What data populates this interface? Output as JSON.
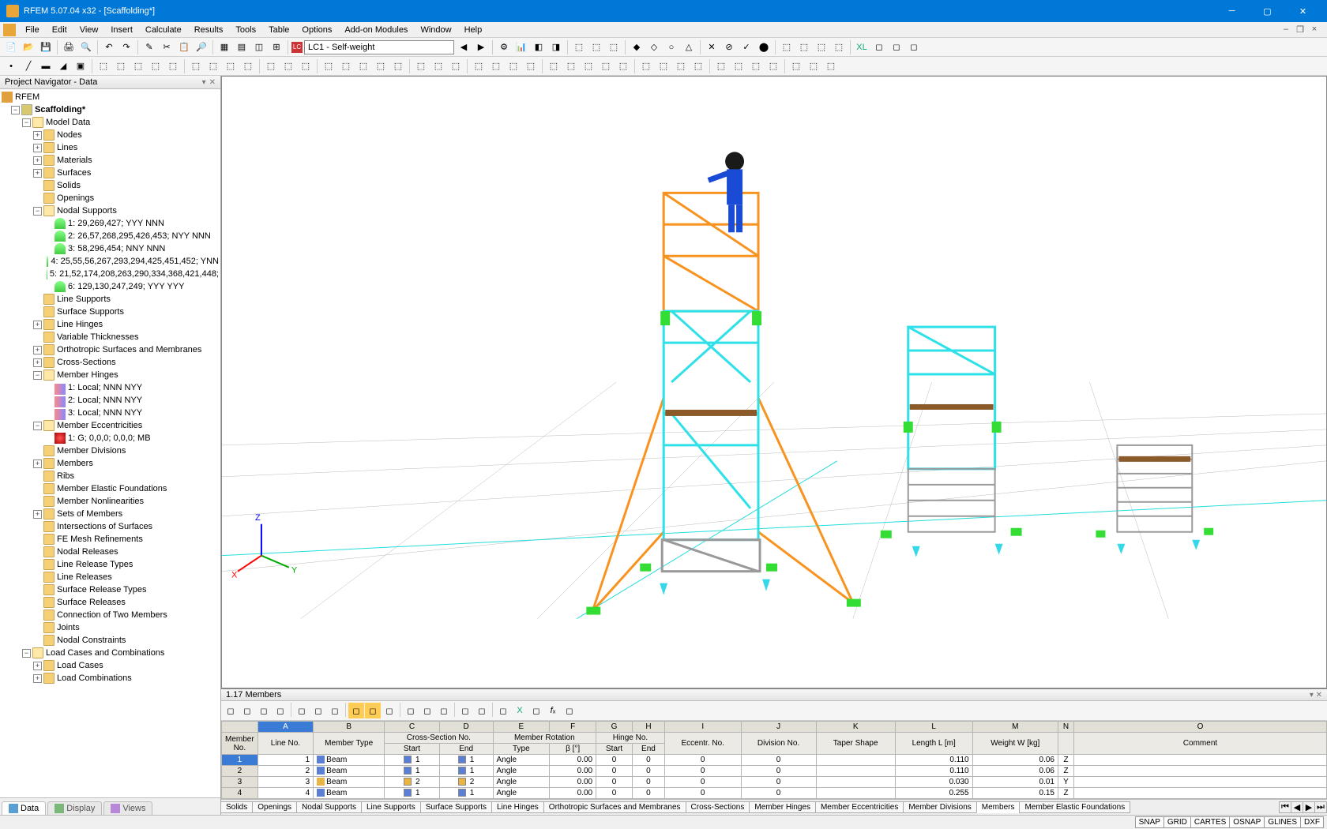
{
  "window": {
    "title": "RFEM 5.07.04 x32 - [Scaffolding*]"
  },
  "menu": [
    "File",
    "Edit",
    "View",
    "Insert",
    "Calculate",
    "Results",
    "Tools",
    "Table",
    "Options",
    "Add-on Modules",
    "Window",
    "Help"
  ],
  "loadcase": {
    "icon": "LC",
    "text": "LC1 - Self-weight"
  },
  "navigator": {
    "title": "Project Navigator - Data",
    "root": "RFEM",
    "project": "Scaffolding*",
    "model_data": "Model Data",
    "tree": [
      {
        "d": 3,
        "e": "+",
        "ic": "folder",
        "t": "Nodes"
      },
      {
        "d": 3,
        "e": "+",
        "ic": "folder",
        "t": "Lines"
      },
      {
        "d": 3,
        "e": "+",
        "ic": "folder",
        "t": "Materials"
      },
      {
        "d": 3,
        "e": "+",
        "ic": "folder",
        "t": "Surfaces"
      },
      {
        "d": 3,
        "e": "",
        "ic": "folder",
        "t": "Solids"
      },
      {
        "d": 3,
        "e": "",
        "ic": "folder",
        "t": "Openings"
      },
      {
        "d": 3,
        "e": "-",
        "ic": "folder-o",
        "t": "Nodal Supports"
      },
      {
        "d": 4,
        "e": "",
        "ic": "sup",
        "t": "1: 29,269,427; YYY NNN"
      },
      {
        "d": 4,
        "e": "",
        "ic": "sup",
        "t": "2: 26,57,268,295,426,453; NYY NNN"
      },
      {
        "d": 4,
        "e": "",
        "ic": "sup",
        "t": "3: 58,296,454; NNY NNN"
      },
      {
        "d": 4,
        "e": "",
        "ic": "sup",
        "t": "4: 25,55,56,267,293,294,425,451,452; YNN"
      },
      {
        "d": 4,
        "e": "",
        "ic": "sup",
        "t": "5: 21,52,174,208,263,290,334,368,421,448;"
      },
      {
        "d": 4,
        "e": "",
        "ic": "sup",
        "t": "6: 129,130,247,249; YYY YYY"
      },
      {
        "d": 3,
        "e": "",
        "ic": "folder",
        "t": "Line Supports"
      },
      {
        "d": 3,
        "e": "",
        "ic": "folder",
        "t": "Surface Supports"
      },
      {
        "d": 3,
        "e": "+",
        "ic": "folder",
        "t": "Line Hinges"
      },
      {
        "d": 3,
        "e": "",
        "ic": "folder",
        "t": "Variable Thicknesses"
      },
      {
        "d": 3,
        "e": "+",
        "ic": "folder",
        "t": "Orthotropic Surfaces and Membranes"
      },
      {
        "d": 3,
        "e": "+",
        "ic": "folder",
        "t": "Cross-Sections"
      },
      {
        "d": 3,
        "e": "-",
        "ic": "folder-o",
        "t": "Member Hinges"
      },
      {
        "d": 4,
        "e": "",
        "ic": "hinge",
        "t": "1: Local; NNN NYY"
      },
      {
        "d": 4,
        "e": "",
        "ic": "hinge",
        "t": "2: Local; NNN NYY"
      },
      {
        "d": 4,
        "e": "",
        "ic": "hinge",
        "t": "3: Local; NNN NYY"
      },
      {
        "d": 3,
        "e": "-",
        "ic": "folder-o",
        "t": "Member Eccentricities"
      },
      {
        "d": 4,
        "e": "",
        "ic": "ecc",
        "t": "1: G; 0,0,0; 0,0,0; MB"
      },
      {
        "d": 3,
        "e": "",
        "ic": "folder",
        "t": "Member Divisions"
      },
      {
        "d": 3,
        "e": "+",
        "ic": "folder",
        "t": "Members"
      },
      {
        "d": 3,
        "e": "",
        "ic": "folder",
        "t": "Ribs"
      },
      {
        "d": 3,
        "e": "",
        "ic": "folder",
        "t": "Member Elastic Foundations"
      },
      {
        "d": 3,
        "e": "",
        "ic": "folder",
        "t": "Member Nonlinearities"
      },
      {
        "d": 3,
        "e": "+",
        "ic": "folder",
        "t": "Sets of Members"
      },
      {
        "d": 3,
        "e": "",
        "ic": "folder",
        "t": "Intersections of Surfaces"
      },
      {
        "d": 3,
        "e": "",
        "ic": "folder",
        "t": "FE Mesh Refinements"
      },
      {
        "d": 3,
        "e": "",
        "ic": "folder",
        "t": "Nodal Releases"
      },
      {
        "d": 3,
        "e": "",
        "ic": "folder",
        "t": "Line Release Types"
      },
      {
        "d": 3,
        "e": "",
        "ic": "folder",
        "t": "Line Releases"
      },
      {
        "d": 3,
        "e": "",
        "ic": "folder",
        "t": "Surface Release Types"
      },
      {
        "d": 3,
        "e": "",
        "ic": "folder",
        "t": "Surface Releases"
      },
      {
        "d": 3,
        "e": "",
        "ic": "folder",
        "t": "Connection of Two Members"
      },
      {
        "d": 3,
        "e": "",
        "ic": "folder",
        "t": "Joints"
      },
      {
        "d": 3,
        "e": "",
        "ic": "folder",
        "t": "Nodal Constraints"
      }
    ],
    "load_section": "Load Cases and Combinations",
    "load_children": [
      "Load Cases",
      "Load Combinations"
    ],
    "tabs": [
      "Data",
      "Display",
      "Views"
    ]
  },
  "table_panel": {
    "title": "1.17 Members",
    "col_letters": [
      "A",
      "B",
      "C",
      "D",
      "E",
      "F",
      "G",
      "H",
      "I",
      "J",
      "K",
      "L",
      "M",
      "N",
      "O"
    ],
    "group_headers": {
      "member_no": "Member\nNo.",
      "line_no": "Line\nNo.",
      "member_type": "Member Type",
      "cs": "Cross-Section No.",
      "cs_start": "Start",
      "cs_end": "End",
      "rot": "Member Rotation",
      "rot_type": "Type",
      "rot_beta": "β [°]",
      "hinge": "Hinge No.",
      "hinge_start": "Start",
      "hinge_end": "End",
      "ecc": "Eccentr.\nNo.",
      "div": "Division\nNo.",
      "taper": "Taper\nShape",
      "length": "Length\nL [m]",
      "weight": "Weight\nW [kg]",
      "axis": "",
      "comment": "Comment"
    },
    "rows": [
      {
        "n": 1,
        "line": 1,
        "type": "Beam",
        "csS": {
          "c": "#5a7fd4",
          "v": 1
        },
        "csE": {
          "c": "#5a7fd4",
          "v": 1
        },
        "rt": "Angle",
        "rb": "0.00",
        "hs": 0,
        "he": 0,
        "ec": 0,
        "dv": 0,
        "len": "0.110",
        "wt": "0.06",
        "ax": "Z"
      },
      {
        "n": 2,
        "line": 2,
        "type": "Beam",
        "csS": {
          "c": "#5a7fd4",
          "v": 1
        },
        "csE": {
          "c": "#5a7fd4",
          "v": 1
        },
        "rt": "Angle",
        "rb": "0.00",
        "hs": 0,
        "he": 0,
        "ec": 0,
        "dv": 0,
        "len": "0.110",
        "wt": "0.06",
        "ax": "Z"
      },
      {
        "n": 3,
        "line": 3,
        "type": "Beam",
        "csS": {
          "c": "#e8b542",
          "v": 2
        },
        "csE": {
          "c": "#e8b542",
          "v": 2
        },
        "rt": "Angle",
        "rb": "0.00",
        "hs": 0,
        "he": 0,
        "ec": 0,
        "dv": 0,
        "len": "0.030",
        "wt": "0.01",
        "ax": "Y"
      },
      {
        "n": 4,
        "line": 4,
        "type": "Beam",
        "csS": {
          "c": "#5a7fd4",
          "v": 1
        },
        "csE": {
          "c": "#5a7fd4",
          "v": 1
        },
        "rt": "Angle",
        "rb": "0.00",
        "hs": 0,
        "he": 0,
        "ec": 0,
        "dv": 0,
        "len": "0.255",
        "wt": "0.15",
        "ax": "Z"
      }
    ],
    "tabs": [
      "Solids",
      "Openings",
      "Nodal Supports",
      "Line Supports",
      "Surface Supports",
      "Line Hinges",
      "Orthotropic Surfaces and Membranes",
      "Cross-Sections",
      "Member Hinges",
      "Member Eccentricities",
      "Member Divisions",
      "Members",
      "Member Elastic Foundations"
    ],
    "active_tab": 11
  },
  "statusbar": [
    "SNAP",
    "GRID",
    "CARTES",
    "OSNAP",
    "GLINES",
    "DXF"
  ]
}
